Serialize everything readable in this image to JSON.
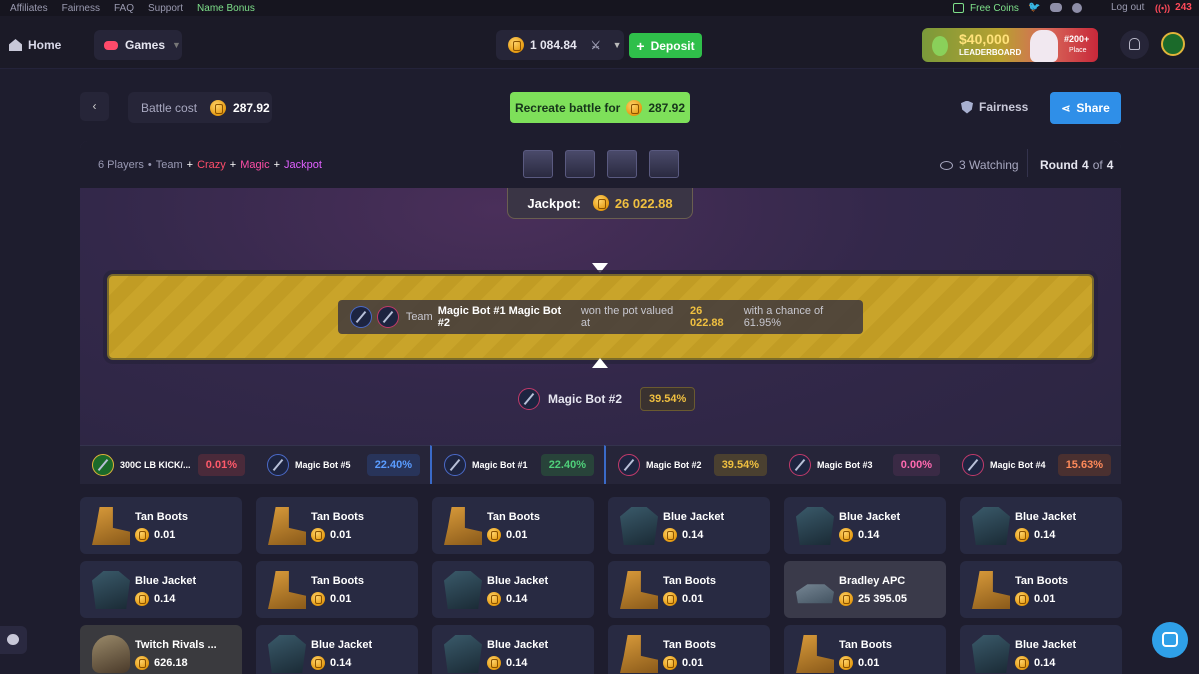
{
  "topbar": {
    "links": [
      "Affiliates",
      "Fairness",
      "FAQ",
      "Support"
    ],
    "bonus_link": "Name Bonus",
    "free_coins": "Free Coins",
    "logout": "Log out",
    "online_count": "243"
  },
  "header": {
    "home": "Home",
    "games": "Games",
    "balance": "1 084.84",
    "deposit": "Deposit",
    "leaderboard_amount": "$40,000",
    "leaderboard_label": "LEADERBOARD",
    "leaderboard_place": "#200+",
    "leaderboard_place_label": "Place"
  },
  "battle": {
    "cost_label": "Battle cost",
    "cost": "287.92",
    "recreate_label": "Recreate battle for",
    "recreate_cost": "287.92",
    "fairness": "Fairness",
    "share": "Share",
    "mode_players": "6 Players",
    "mode_sep": "•",
    "mode_team": "Team",
    "mode_plus": "+",
    "mode_crazy": "Crazy",
    "mode_magic": "Magic",
    "mode_jackpot": "Jackpot",
    "watching": "3 Watching",
    "round_label": "Round",
    "round_current": "4",
    "round_of": "of",
    "round_total": "4",
    "jackpot_label": "Jackpot:",
    "jackpot_value": "26 022.88",
    "result_team": "Team",
    "result_names": "Magic Bot #1 Magic Bot #2",
    "result_won": "won the pot valued at",
    "result_value": "26 022.88",
    "result_chance": "with a chance of 61.95%",
    "winner_name": "Magic Bot #2",
    "winner_pct": "39.54%"
  },
  "players": [
    {
      "name": "300C LB KICK/...",
      "pct": "0.01%"
    },
    {
      "name": "Magic Bot #5",
      "pct": "22.40%"
    },
    {
      "name": "Magic Bot #1",
      "pct": "22.40%"
    },
    {
      "name": "Magic Bot #2",
      "pct": "39.54%"
    },
    {
      "name": "Magic Bot #3",
      "pct": "0.00%"
    },
    {
      "name": "Magic Bot #4",
      "pct": "15.63%"
    }
  ],
  "items": [
    {
      "name": "Tan Boots",
      "price": "0.01",
      "icon": "boots-icon"
    },
    {
      "name": "Tan Boots",
      "price": "0.01",
      "icon": "boots-icon"
    },
    {
      "name": "Tan Boots",
      "price": "0.01",
      "icon": "boots-icon"
    },
    {
      "name": "Blue Jacket",
      "price": "0.14",
      "icon": "jacket-icon"
    },
    {
      "name": "Blue Jacket",
      "price": "0.14",
      "icon": "jacket-icon"
    },
    {
      "name": "Blue Jacket",
      "price": "0.14",
      "icon": "jacket-icon"
    },
    {
      "name": "Blue Jacket",
      "price": "0.14",
      "icon": "jacket-icon"
    },
    {
      "name": "Tan Boots",
      "price": "0.01",
      "icon": "boots-icon"
    },
    {
      "name": "Blue Jacket",
      "price": "0.14",
      "icon": "jacket-icon"
    },
    {
      "name": "Tan Boots",
      "price": "0.01",
      "icon": "boots-icon"
    },
    {
      "name": "Bradley APC",
      "price": "25 395.05",
      "icon": "tank-icon"
    },
    {
      "name": "Tan Boots",
      "price": "0.01",
      "icon": "boots-icon"
    },
    {
      "name": "Twitch Rivals ...",
      "price": "626.18",
      "icon": "figure-icon"
    },
    {
      "name": "Blue Jacket",
      "price": "0.14",
      "icon": "jacket-icon"
    },
    {
      "name": "Blue Jacket",
      "price": "0.14",
      "icon": "jacket-icon"
    },
    {
      "name": "Tan Boots",
      "price": "0.01",
      "icon": "boots-icon"
    },
    {
      "name": "Tan Boots",
      "price": "0.01",
      "icon": "boots-icon"
    },
    {
      "name": "Blue Jacket",
      "price": "0.14",
      "icon": "jacket-icon"
    }
  ],
  "colors": {
    "accent_green": "#2fbf4a",
    "accent_blue": "#2f7fe0",
    "gold": "#e0b43a",
    "pink": "#ff4da6",
    "red_pct": "#ff5a6a",
    "green_pct": "#4fd07a",
    "blue_pct": "#5a9cff"
  }
}
